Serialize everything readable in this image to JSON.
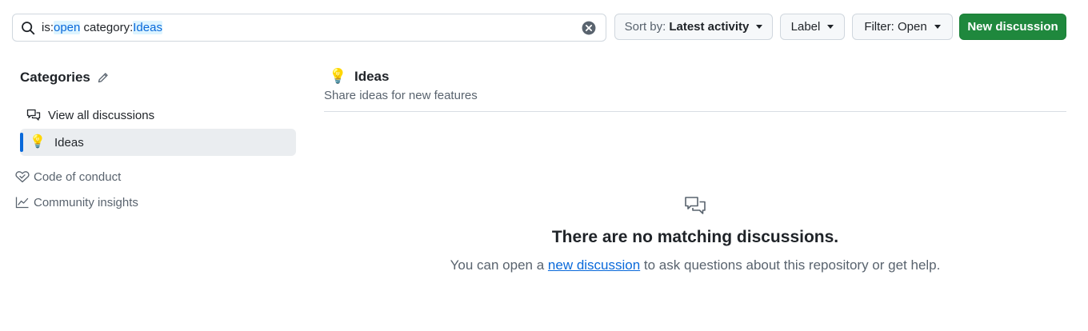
{
  "search": {
    "prefix_1": "is:",
    "value_1": "open",
    "prefix_2": " category:",
    "value_2": "Ideas"
  },
  "toolbar": {
    "sort_prefix": "Sort by:",
    "sort_value": "Latest activity",
    "label_button": "Label",
    "filter_button": "Filter: Open",
    "new_discussion": "New discussion"
  },
  "sidebar": {
    "categories_title": "Categories",
    "view_all": "View all discussions",
    "ideas_emoji": "💡",
    "ideas_label": "Ideas",
    "code_of_conduct": "Code of conduct",
    "community_insights": "Community insights"
  },
  "main": {
    "category_emoji": "💡",
    "category_name": "Ideas",
    "category_desc": "Share ideas for new features",
    "empty_title": "There are no matching discussions.",
    "empty_before": "You can open a ",
    "empty_link": "new discussion",
    "empty_after": " to ask questions about this repository or get help."
  },
  "colors": {
    "accent": "#0969da",
    "primary_button": "#1f883d"
  },
  "icons": [
    "search-icon",
    "clear-icon",
    "caret-down-icon",
    "pencil-icon",
    "discussions-icon",
    "heart-shield-icon",
    "graph-icon"
  ]
}
